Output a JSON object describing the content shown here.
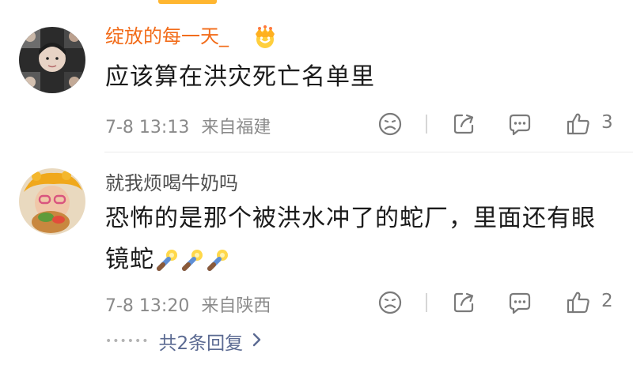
{
  "comments": [
    {
      "username": "绽放的每一天_",
      "content": "应该算在洪灾死亡名单里",
      "time": "7-8 13:13",
      "location": "来自福建",
      "likes": "3"
    },
    {
      "username": "就我烦喝牛奶吗",
      "content": "恐怖的是那个被洪水冲了的蛇厂，里面还有眼镜蛇",
      "time": "7-8 13:20",
      "location": "来自陕西",
      "likes": "2",
      "replies_label": "共2条回复"
    }
  ],
  "icons": [
    "vip-crown-icon",
    "dislike-icon",
    "share-icon",
    "comment-icon",
    "like-icon",
    "chevron-right-icon",
    "snake-emoji-icon"
  ],
  "colors": {
    "vip_name": "#f26c1a",
    "username": "#4e4e4e",
    "reply_link": "#5b6a92",
    "meta": "#8a8a8a"
  }
}
